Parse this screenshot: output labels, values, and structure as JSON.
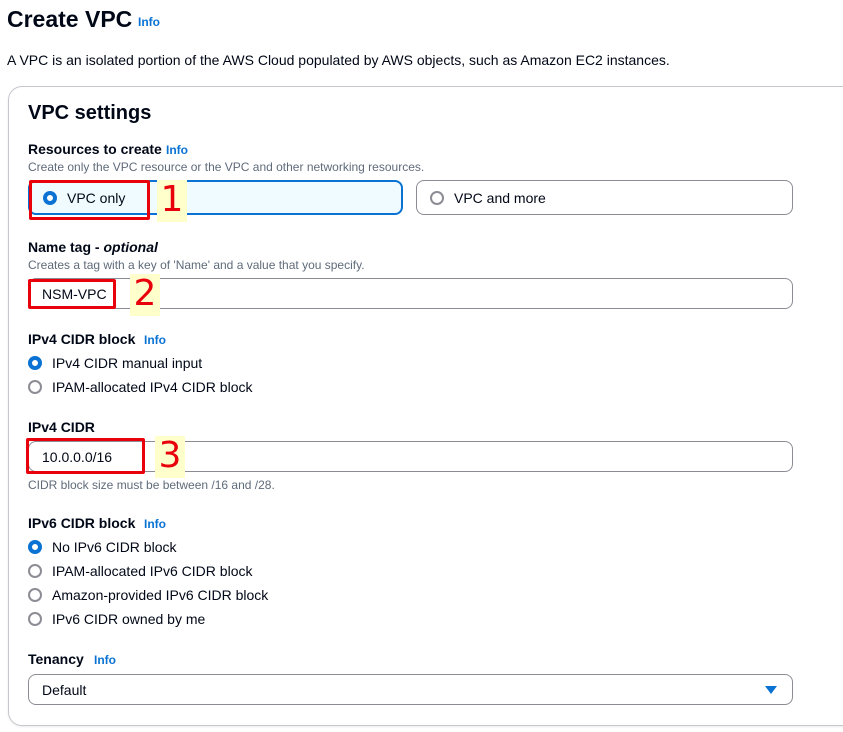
{
  "header": {
    "title": "Create VPC",
    "info": "Info",
    "description": "A VPC is an isolated portion of the AWS Cloud populated by AWS objects, such as Amazon EC2 instances."
  },
  "settings": {
    "title": "VPC settings",
    "resources": {
      "label": "Resources to create",
      "info": "Info",
      "description": "Create only the VPC resource or the VPC and other networking resources.",
      "options": [
        "VPC only",
        "VPC and more"
      ],
      "selected": "VPC only"
    },
    "name_tag": {
      "label": "Name tag - ",
      "optional": "optional",
      "description": "Creates a tag with a key of 'Name' and a value that you specify.",
      "value": "NSM-VPC"
    },
    "ipv4_block": {
      "label": "IPv4 CIDR block",
      "info": "Info",
      "options": [
        "IPv4 CIDR manual input",
        "IPAM-allocated IPv4 CIDR block"
      ],
      "selected": "IPv4 CIDR manual input"
    },
    "ipv4_cidr": {
      "label": "IPv4 CIDR",
      "value": "10.0.0.0/16",
      "hint": "CIDR block size must be between /16 and /28."
    },
    "ipv6_block": {
      "label": "IPv6 CIDR block",
      "info": "Info",
      "options": [
        "No IPv6 CIDR block",
        "IPAM-allocated IPv6 CIDR block",
        "Amazon-provided IPv6 CIDR block",
        "IPv6 CIDR owned by me"
      ],
      "selected": "No IPv6 CIDR block"
    },
    "tenancy": {
      "label": "Tenancy",
      "info": "Info",
      "value": "Default"
    }
  },
  "annotations": [
    "1",
    "2",
    "3"
  ],
  "colors": {
    "accent": "#0972d3",
    "annotation": "#e8000b",
    "annotation_bg": "#ffffcc"
  }
}
